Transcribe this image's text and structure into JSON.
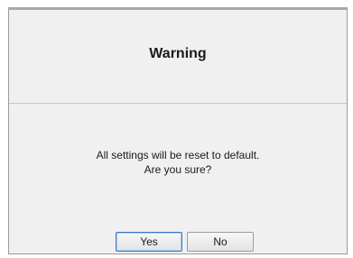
{
  "dialog": {
    "title": "Warning",
    "message_lines": [
      "All settings will be reset to default.",
      "Are you sure?"
    ],
    "buttons": {
      "yes_label": "Yes",
      "no_label": "No"
    },
    "default_button": "Yes",
    "colors": {
      "background": "#f0f0f0",
      "default_button_border": "#3d7bbf"
    }
  }
}
